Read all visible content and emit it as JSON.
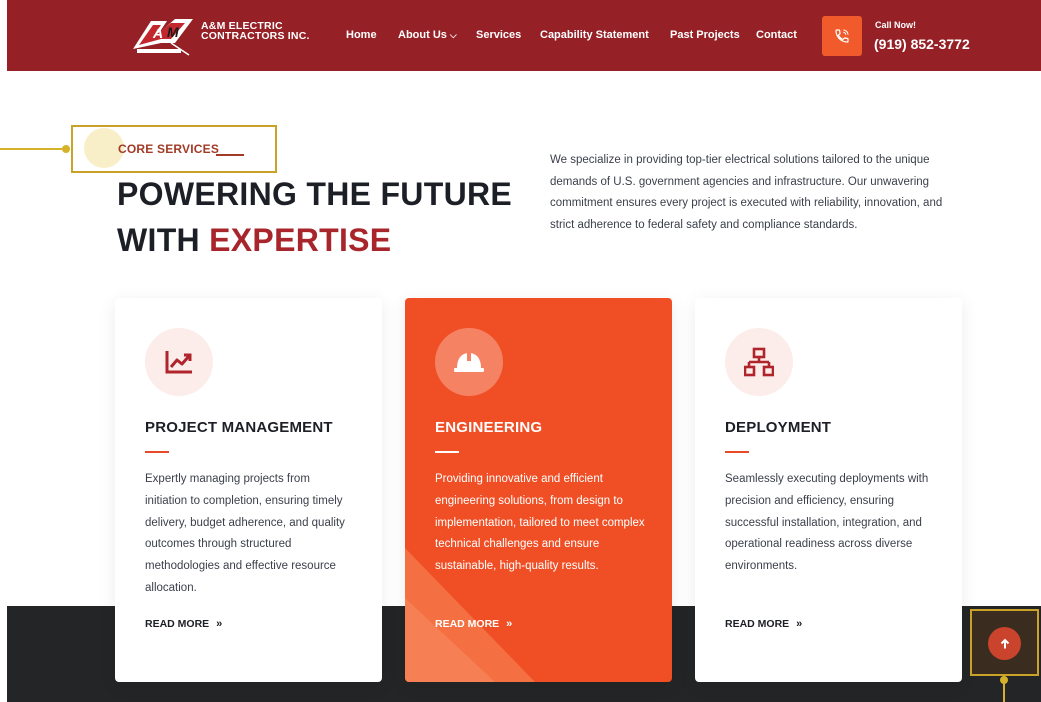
{
  "header": {
    "logo_title": "A&M ELECTRIC",
    "logo_subtitle": "CONTRACTORS INC.",
    "nav": [
      "Home",
      "About Us",
      "Services",
      "Capability Statement",
      "Past Projects",
      "Contact"
    ],
    "call_label": "Call Now!",
    "call_number": "(919) 852-3772"
  },
  "intro": {
    "tag": "CORE SERVICES",
    "headline_line1": "POWERING THE FUTURE",
    "headline_line2_prefix": "WITH ",
    "headline_line2_accent": "EXPERTISE",
    "description": "We specialize in providing top-tier electrical solutions tailored to the unique demands of U.S. government agencies and infrastructure. Our unwavering commitment ensures every project is executed with reliability, innovation, and strict adherence to federal safety and compliance standards."
  },
  "cards": [
    {
      "icon": "chart-trend-icon",
      "title": "PROJECT MANAGEMENT",
      "text": "Expertly managing projects from initiation to completion, ensuring timely delivery, budget adherence, and quality outcomes through structured methodologies and effective resource allocation.",
      "cta": "READ MORE"
    },
    {
      "icon": "hard-hat-icon",
      "title": "ENGINEERING",
      "text": "Providing innovative and efficient engineering solutions, from design to implementation, tailored to meet complex technical challenges and ensure sustainable, high-quality results.",
      "cta": "READ MORE"
    },
    {
      "icon": "network-icon",
      "title": "DEPLOYMENT",
      "text": "Seamlessly executing deployments with precision and efficiency, ensuring successful installation, integration, and operational readiness across diverse environments.",
      "cta": "READ MORE"
    }
  ],
  "colors": {
    "header_bg": "#952026",
    "accent": "#a8262b",
    "active_card": "#f04f25",
    "annotation": "#c9a227",
    "dark_band": "#242526"
  }
}
